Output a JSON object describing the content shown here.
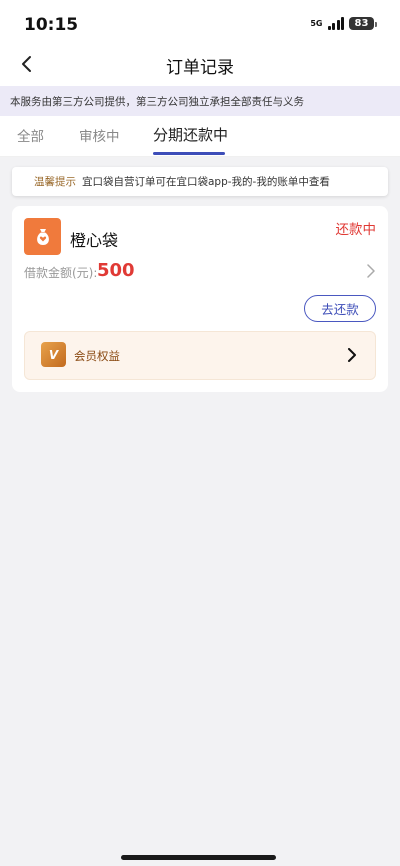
{
  "status_bar": {
    "time": "10:15",
    "network": "5G",
    "battery": "83"
  },
  "nav": {
    "title": "订单记录",
    "back_icon": "chevron-left-icon"
  },
  "notice": "本服务由第三方公司提供，第三方公司独立承担全部责任与义务",
  "tabs": [
    {
      "label": "全部",
      "active": false
    },
    {
      "label": "审核中",
      "active": false
    },
    {
      "label": "分期还款中",
      "active": true
    }
  ],
  "tip": {
    "label": "温馨提示",
    "text": "宜口袋自营订单可在宜口袋app-我的-我的账单中查看"
  },
  "order": {
    "product_name": "橙心袋",
    "status": "还款中",
    "amount_label": "借款金额(元):",
    "amount": "500",
    "repay_button": "去还款",
    "vip_label": "会员权益",
    "vip_icon_text": "V"
  },
  "colors": {
    "accent": "#3d4db8",
    "status_red": "#e03a35",
    "logo_orange": "#f07a3c",
    "notice_bg": "#eceaf7",
    "vip_bg": "#fdf4ec"
  }
}
